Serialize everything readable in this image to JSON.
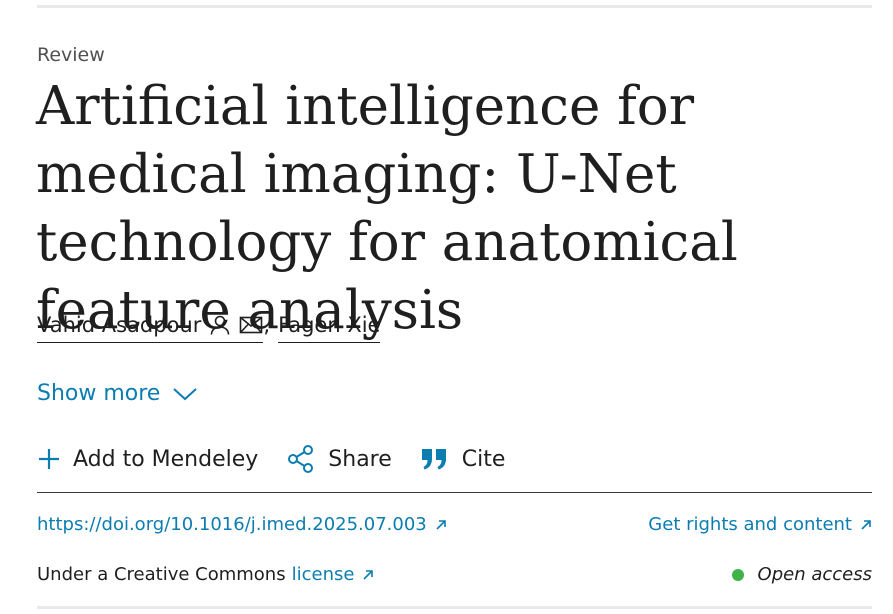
{
  "article": {
    "type": "Review",
    "title": "Artificial intelligence for medical imaging: U-Net technology for anatomical feature analysis"
  },
  "authors": [
    {
      "name": "Vahid Asadpour",
      "icons": [
        "person-icon",
        "envelope-icon"
      ]
    },
    {
      "name": "Fagen Xie"
    }
  ],
  "authors_separator": ",",
  "show_more": {
    "label": "Show more",
    "icon": "chevron-down-icon"
  },
  "actions": {
    "mendeley": {
      "label": "Add to Mendeley",
      "icon": "plus-icon"
    },
    "share": {
      "label": "Share",
      "icon": "share-icon"
    },
    "cite": {
      "label": "Cite",
      "icon": "quote-icon"
    }
  },
  "links": {
    "doi": "https://doi.org/10.1016/j.imed.2025.07.003",
    "rights": "Get rights and content"
  },
  "license": {
    "prefix": "Under a Creative Commons",
    "link": "license"
  },
  "access": {
    "label": "Open access",
    "dot_color": "#3fb24a"
  },
  "colors": {
    "link": "#0c7db1",
    "text": "#1f1f1f",
    "muted": "#505050"
  }
}
